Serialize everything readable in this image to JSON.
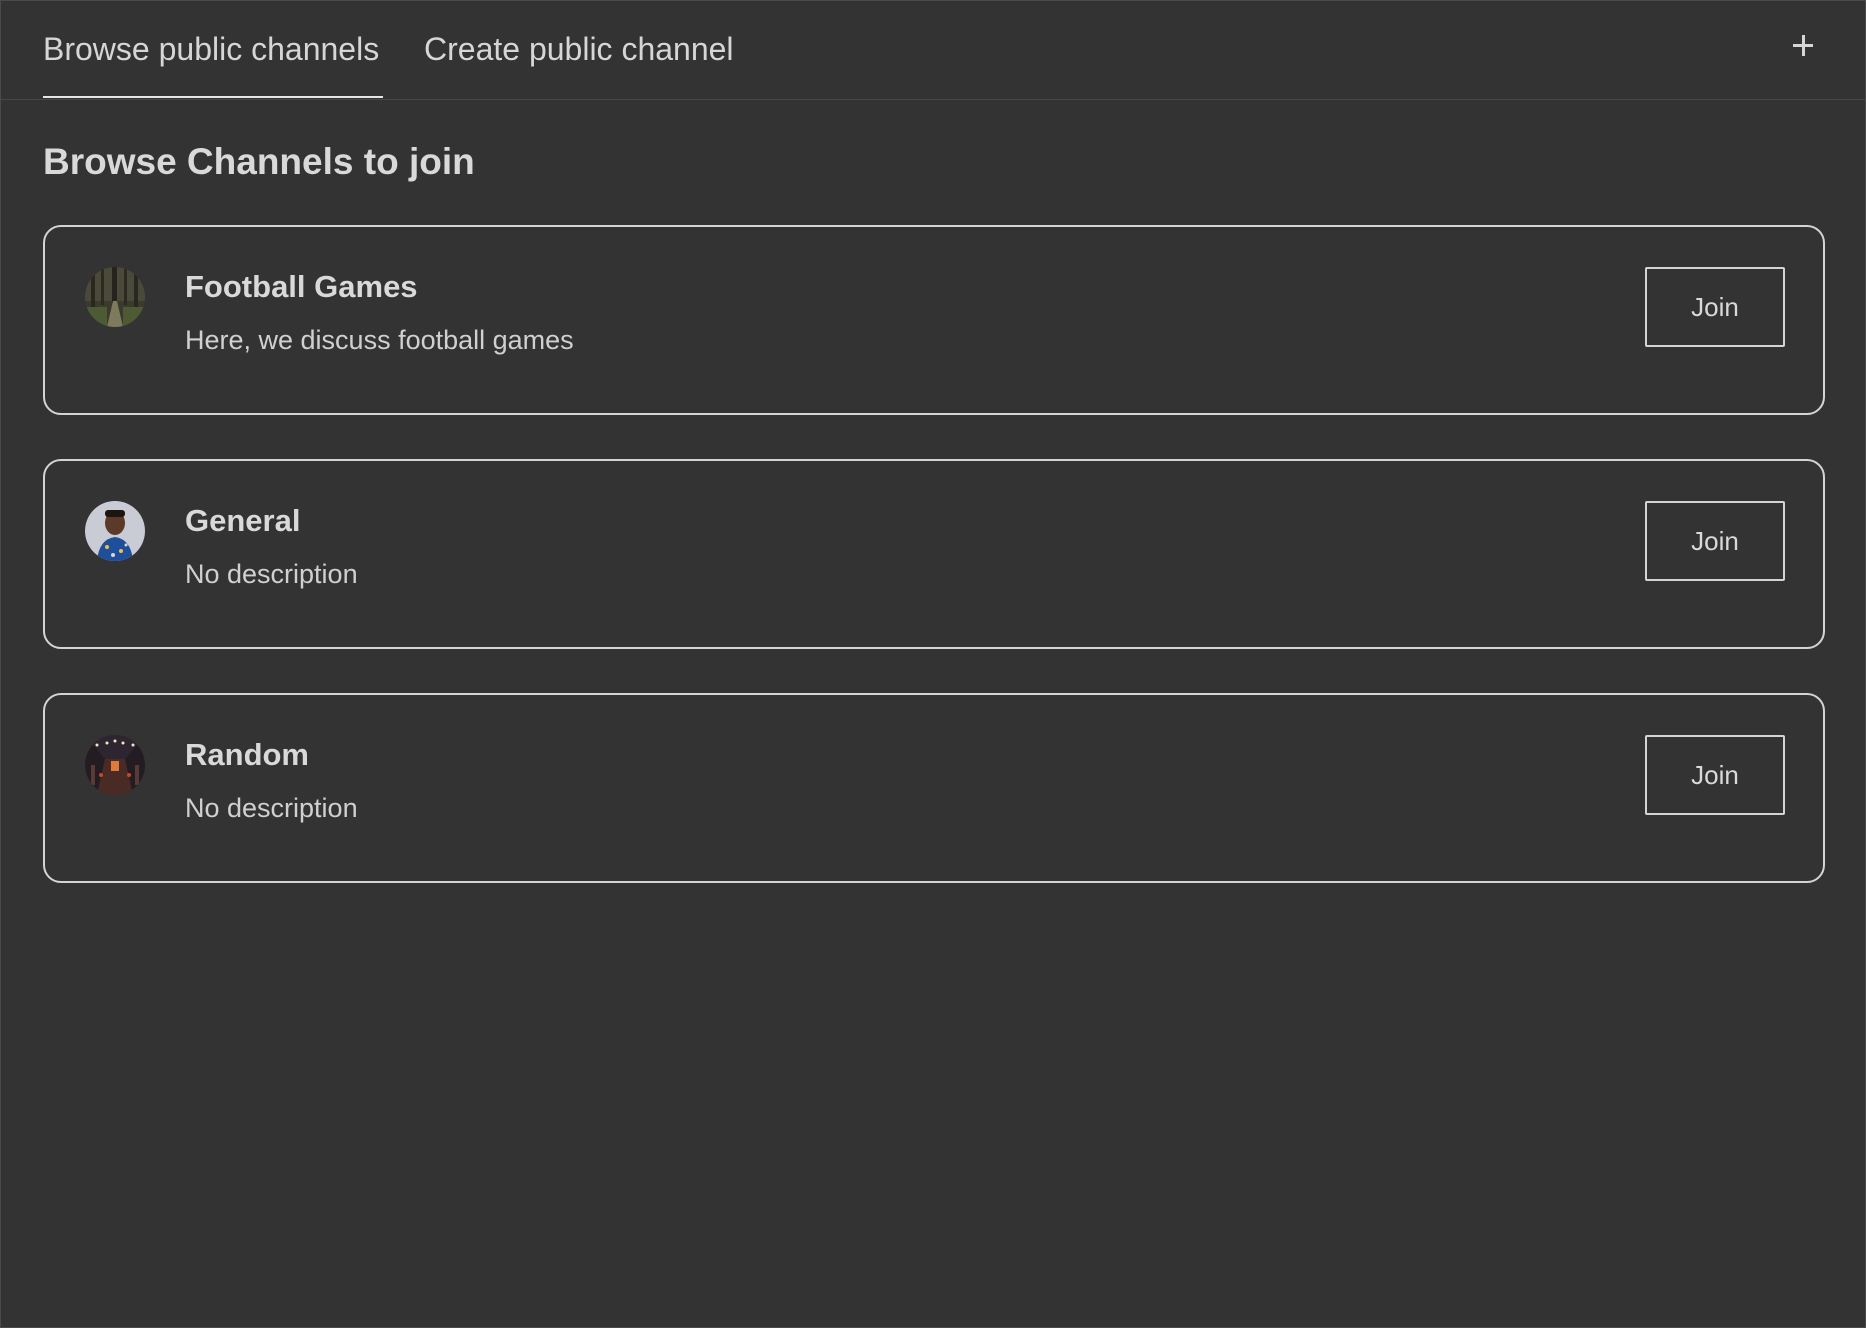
{
  "tabs": {
    "browse_label": "Browse public channels",
    "create_label": "Create public channel",
    "active": "browse"
  },
  "header": {
    "add_icon": "plus-icon"
  },
  "main": {
    "heading": "Browse Channels to join"
  },
  "channels": [
    {
      "name": "Football Games",
      "description": "Here, we discuss football games",
      "join_label": "Join",
      "avatar": "forest-path-photo"
    },
    {
      "name": "General",
      "description": "No description",
      "join_label": "Join",
      "avatar": "person-portrait-photo"
    },
    {
      "name": "Random",
      "description": "No description",
      "join_label": "Join",
      "avatar": "night-corridor-photo"
    }
  ],
  "colors": {
    "background": "#333333",
    "text": "#d9d9d9",
    "border": "#d4d4d4"
  }
}
